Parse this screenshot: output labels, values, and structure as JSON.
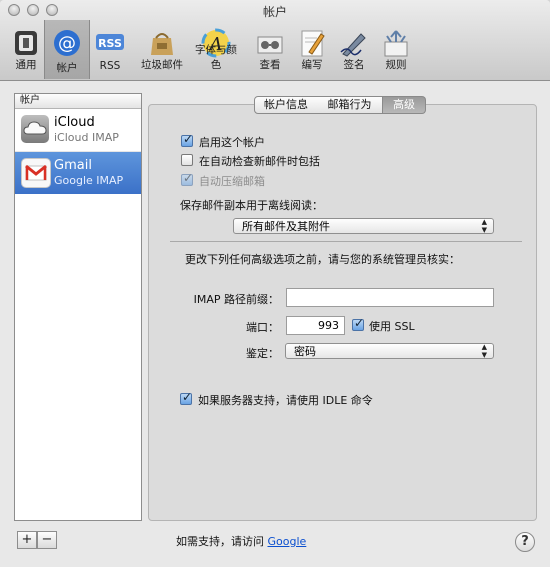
{
  "window": {
    "title": "帐户"
  },
  "toolbar": {
    "items": [
      {
        "label": "通用",
        "icon": "general-switch-icon"
      },
      {
        "label": "帐户",
        "icon": "at-sign-icon",
        "selected": true
      },
      {
        "label": "RSS",
        "icon": "rss-icon"
      },
      {
        "label": "垃圾邮件",
        "icon": "junk-mail-bag-icon"
      },
      {
        "label": "字体与颜色",
        "icon": "fonts-colors-icon"
      },
      {
        "label": "查看",
        "icon": "viewing-glasses-icon"
      },
      {
        "label": "编写",
        "icon": "composing-pencil-icon"
      },
      {
        "label": "签名",
        "icon": "signature-pen-icon"
      },
      {
        "label": "规则",
        "icon": "rules-arrows-icon"
      }
    ]
  },
  "accounts": {
    "header": "帐户",
    "items": [
      {
        "name": "iCloud",
        "sub": "iCloud IMAP",
        "icon": "icloud-icon"
      },
      {
        "name": "Gmail",
        "sub": "Google IMAP",
        "icon": "gmail-icon",
        "selected": true
      }
    ],
    "add_label": "+",
    "remove_label": "−"
  },
  "tabs": [
    {
      "label": "帐户信息"
    },
    {
      "label": "邮箱行为"
    },
    {
      "label": "高级",
      "selected": true
    }
  ],
  "advanced": {
    "enable_account": {
      "label": "启用这个帐户",
      "checked": true
    },
    "include_check": {
      "label": "在自动检查新邮件时包括",
      "checked": false
    },
    "auto_compact": {
      "label": "自动压缩邮箱",
      "checked": true,
      "disabled": true
    },
    "keep_copies_label": "保存邮件副本用于离线阅读：",
    "keep_copies_value": "所有邮件及其附件",
    "admin_note": "更改下列任何高级选项之前，请与您的系统管理员核实：",
    "imap_prefix_label": "IMAP 路径前缀：",
    "imap_prefix_value": "",
    "port_label": "端口：",
    "port_value": "993",
    "ssl": {
      "label": "使用 SSL",
      "checked": true
    },
    "auth_label": "鉴定：",
    "auth_value": "密码",
    "idle": {
      "label": "如果服务器支持，请使用 IDLE 命令",
      "checked": true
    }
  },
  "footer": {
    "text": "如需支持，请访问",
    "link": "Google",
    "help": "?"
  },
  "colors": {
    "selection": "#3b71c8",
    "link": "#0b4fcf"
  }
}
